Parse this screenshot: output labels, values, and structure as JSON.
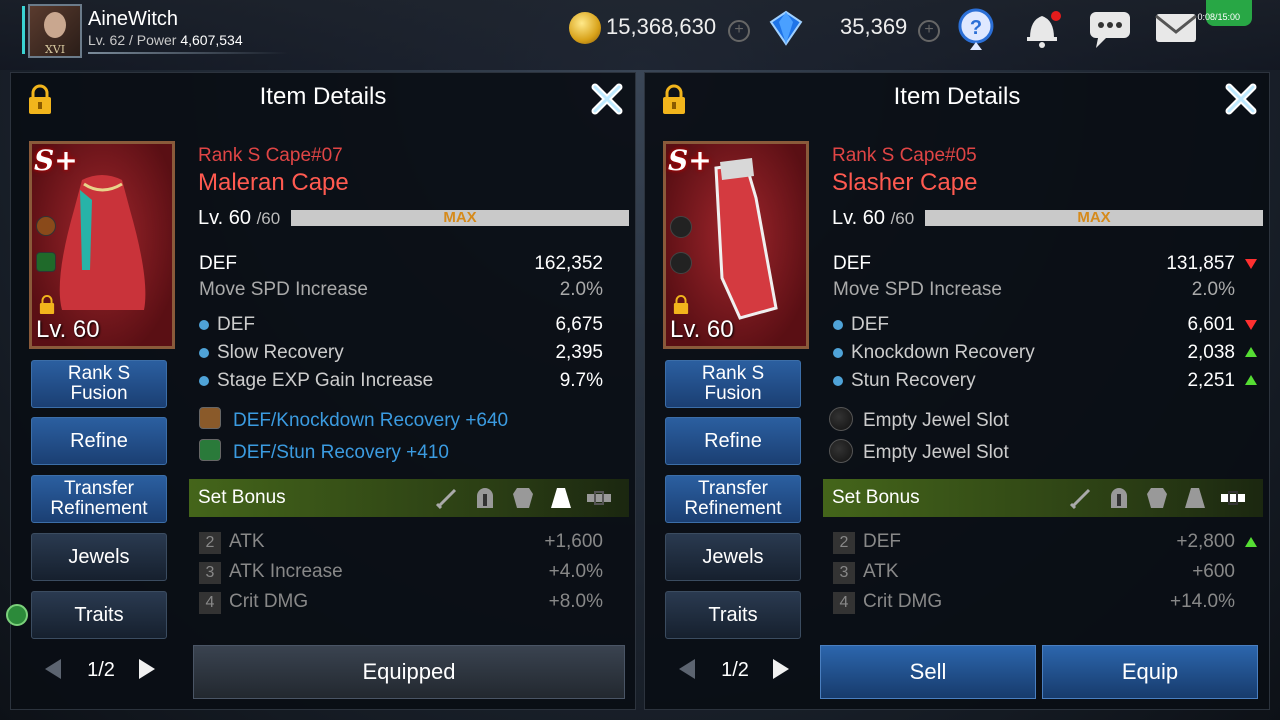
{
  "topbar": {
    "username": "AineWitch",
    "avatar_rank": "XVI",
    "level_label": "Lv. 62 / Power",
    "power": "4,607,534",
    "gold": "15,368,630",
    "gems": "35,369",
    "timer": "0:08/15:00"
  },
  "left_panel": {
    "title": "Item Details",
    "item": {
      "rank_badge": "S+",
      "card_level": "Lv. 60",
      "rank_name": "Rank S Cape#07",
      "name": "Maleran Cape",
      "level": "Lv. 60",
      "level_max": "/60",
      "max_label": "MAX",
      "base_stats": [
        {
          "label": "DEF",
          "value": "162,352"
        },
        {
          "label": "Move SPD Increase",
          "value": "2.0%"
        }
      ],
      "sub_stats": [
        {
          "label": "DEF",
          "value": "6,675"
        },
        {
          "label": "Slow Recovery",
          "value": "2,395"
        },
        {
          "label": "Stage EXP Gain Increase",
          "value": "9.7%"
        }
      ],
      "jewels": [
        {
          "label": "DEF/Knockdown Recovery +640",
          "color": "#8a5a2a"
        },
        {
          "label": "DEF/Stun Recovery +410",
          "color": "#2a7a3a"
        }
      ]
    },
    "buttons": {
      "fusion": "Rank S\nFusion",
      "refine": "Refine",
      "transfer": "Transfer\nRefinement",
      "jewels": "Jewels",
      "traits": "Traits"
    },
    "pager": "1/2",
    "set_bonus": {
      "label": "Set Bonus",
      "rows": [
        {
          "n": "2",
          "label": "ATK",
          "value": "+1,600"
        },
        {
          "n": "3",
          "label": "ATK Increase",
          "value": "+4.0%"
        },
        {
          "n": "4",
          "label": "Crit DMG",
          "value": "+8.0%"
        }
      ]
    },
    "action": "Equipped"
  },
  "right_panel": {
    "title": "Item Details",
    "item": {
      "rank_badge": "S+",
      "card_level": "Lv. 60",
      "rank_name": "Rank S Cape#05",
      "name": "Slasher Cape",
      "level": "Lv. 60",
      "level_max": "/60",
      "max_label": "MAX",
      "base_stats": [
        {
          "label": "DEF",
          "value": "131,857",
          "trend": "down"
        },
        {
          "label": "Move SPD Increase",
          "value": "2.0%",
          "trend": ""
        }
      ],
      "sub_stats": [
        {
          "label": "DEF",
          "value": "6,601",
          "trend": "down"
        },
        {
          "label": "Knockdown Recovery",
          "value": "2,038",
          "trend": "up"
        },
        {
          "label": "Stun Recovery",
          "value": "2,251",
          "trend": "up"
        }
      ],
      "empty_slots": [
        "Empty Jewel Slot",
        "Empty Jewel Slot"
      ]
    },
    "buttons": {
      "fusion": "Rank S\nFusion",
      "refine": "Refine",
      "transfer": "Transfer\nRefinement",
      "jewels": "Jewels",
      "traits": "Traits"
    },
    "pager": "1/2",
    "set_bonus": {
      "label": "Set Bonus",
      "rows": [
        {
          "n": "2",
          "label": "DEF",
          "value": "+2,800",
          "trend": "up"
        },
        {
          "n": "3",
          "label": "ATK",
          "value": "+600"
        },
        {
          "n": "4",
          "label": "Crit DMG",
          "value": "+14.0%"
        }
      ]
    },
    "sell": "Sell",
    "equip": "Equip"
  },
  "colors": {
    "item_name": "#ff5a50",
    "jewel_text": "#3b9be0",
    "set_bar": "#44651a",
    "max_text": "#d68a1a"
  }
}
